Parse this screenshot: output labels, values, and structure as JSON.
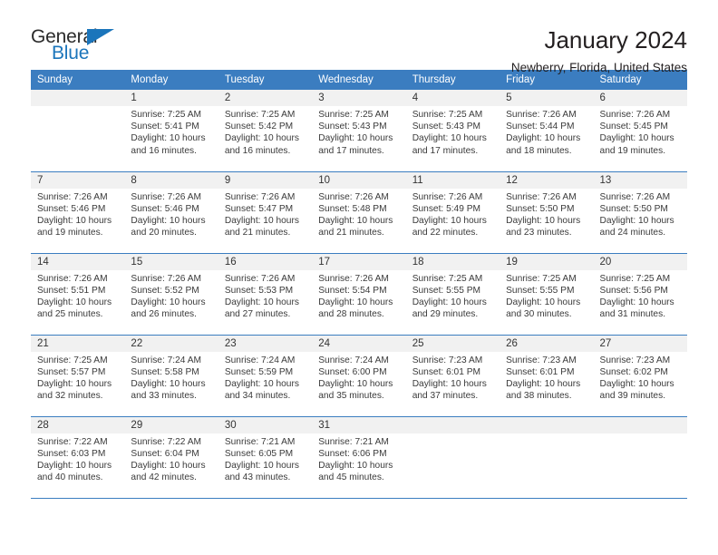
{
  "brand": {
    "name_top": "General",
    "name_bottom": "Blue",
    "triangle_icon": "triangle-icon",
    "color_primary": "#1b75bb",
    "color_text": "#2b2b2b"
  },
  "header": {
    "title": "January 2024",
    "subtitle": "Newberry, Florida, United States"
  },
  "calendar": {
    "header_background": "#3b7dc0",
    "header_text_color": "#ffffff",
    "daynum_band_color": "#f1f1f1",
    "weekday_headers": [
      "Sunday",
      "Monday",
      "Tuesday",
      "Wednesday",
      "Thursday",
      "Friday",
      "Saturday"
    ],
    "weeks": [
      [
        {
          "day": "",
          "lines": []
        },
        {
          "day": "1",
          "lines": [
            "Sunrise: 7:25 AM",
            "Sunset: 5:41 PM",
            "Daylight: 10 hours",
            "and 16 minutes."
          ]
        },
        {
          "day": "2",
          "lines": [
            "Sunrise: 7:25 AM",
            "Sunset: 5:42 PM",
            "Daylight: 10 hours",
            "and 16 minutes."
          ]
        },
        {
          "day": "3",
          "lines": [
            "Sunrise: 7:25 AM",
            "Sunset: 5:43 PM",
            "Daylight: 10 hours",
            "and 17 minutes."
          ]
        },
        {
          "day": "4",
          "lines": [
            "Sunrise: 7:25 AM",
            "Sunset: 5:43 PM",
            "Daylight: 10 hours",
            "and 17 minutes."
          ]
        },
        {
          "day": "5",
          "lines": [
            "Sunrise: 7:26 AM",
            "Sunset: 5:44 PM",
            "Daylight: 10 hours",
            "and 18 minutes."
          ]
        },
        {
          "day": "6",
          "lines": [
            "Sunrise: 7:26 AM",
            "Sunset: 5:45 PM",
            "Daylight: 10 hours",
            "and 19 minutes."
          ]
        }
      ],
      [
        {
          "day": "7",
          "lines": [
            "Sunrise: 7:26 AM",
            "Sunset: 5:46 PM",
            "Daylight: 10 hours",
            "and 19 minutes."
          ]
        },
        {
          "day": "8",
          "lines": [
            "Sunrise: 7:26 AM",
            "Sunset: 5:46 PM",
            "Daylight: 10 hours",
            "and 20 minutes."
          ]
        },
        {
          "day": "9",
          "lines": [
            "Sunrise: 7:26 AM",
            "Sunset: 5:47 PM",
            "Daylight: 10 hours",
            "and 21 minutes."
          ]
        },
        {
          "day": "10",
          "lines": [
            "Sunrise: 7:26 AM",
            "Sunset: 5:48 PM",
            "Daylight: 10 hours",
            "and 21 minutes."
          ]
        },
        {
          "day": "11",
          "lines": [
            "Sunrise: 7:26 AM",
            "Sunset: 5:49 PM",
            "Daylight: 10 hours",
            "and 22 minutes."
          ]
        },
        {
          "day": "12",
          "lines": [
            "Sunrise: 7:26 AM",
            "Sunset: 5:50 PM",
            "Daylight: 10 hours",
            "and 23 minutes."
          ]
        },
        {
          "day": "13",
          "lines": [
            "Sunrise: 7:26 AM",
            "Sunset: 5:50 PM",
            "Daylight: 10 hours",
            "and 24 minutes."
          ]
        }
      ],
      [
        {
          "day": "14",
          "lines": [
            "Sunrise: 7:26 AM",
            "Sunset: 5:51 PM",
            "Daylight: 10 hours",
            "and 25 minutes."
          ]
        },
        {
          "day": "15",
          "lines": [
            "Sunrise: 7:26 AM",
            "Sunset: 5:52 PM",
            "Daylight: 10 hours",
            "and 26 minutes."
          ]
        },
        {
          "day": "16",
          "lines": [
            "Sunrise: 7:26 AM",
            "Sunset: 5:53 PM",
            "Daylight: 10 hours",
            "and 27 minutes."
          ]
        },
        {
          "day": "17",
          "lines": [
            "Sunrise: 7:26 AM",
            "Sunset: 5:54 PM",
            "Daylight: 10 hours",
            "and 28 minutes."
          ]
        },
        {
          "day": "18",
          "lines": [
            "Sunrise: 7:25 AM",
            "Sunset: 5:55 PM",
            "Daylight: 10 hours",
            "and 29 minutes."
          ]
        },
        {
          "day": "19",
          "lines": [
            "Sunrise: 7:25 AM",
            "Sunset: 5:55 PM",
            "Daylight: 10 hours",
            "and 30 minutes."
          ]
        },
        {
          "day": "20",
          "lines": [
            "Sunrise: 7:25 AM",
            "Sunset: 5:56 PM",
            "Daylight: 10 hours",
            "and 31 minutes."
          ]
        }
      ],
      [
        {
          "day": "21",
          "lines": [
            "Sunrise: 7:25 AM",
            "Sunset: 5:57 PM",
            "Daylight: 10 hours",
            "and 32 minutes."
          ]
        },
        {
          "day": "22",
          "lines": [
            "Sunrise: 7:24 AM",
            "Sunset: 5:58 PM",
            "Daylight: 10 hours",
            "and 33 minutes."
          ]
        },
        {
          "day": "23",
          "lines": [
            "Sunrise: 7:24 AM",
            "Sunset: 5:59 PM",
            "Daylight: 10 hours",
            "and 34 minutes."
          ]
        },
        {
          "day": "24",
          "lines": [
            "Sunrise: 7:24 AM",
            "Sunset: 6:00 PM",
            "Daylight: 10 hours",
            "and 35 minutes."
          ]
        },
        {
          "day": "25",
          "lines": [
            "Sunrise: 7:23 AM",
            "Sunset: 6:01 PM",
            "Daylight: 10 hours",
            "and 37 minutes."
          ]
        },
        {
          "day": "26",
          "lines": [
            "Sunrise: 7:23 AM",
            "Sunset: 6:01 PM",
            "Daylight: 10 hours",
            "and 38 minutes."
          ]
        },
        {
          "day": "27",
          "lines": [
            "Sunrise: 7:23 AM",
            "Sunset: 6:02 PM",
            "Daylight: 10 hours",
            "and 39 minutes."
          ]
        }
      ],
      [
        {
          "day": "28",
          "lines": [
            "Sunrise: 7:22 AM",
            "Sunset: 6:03 PM",
            "Daylight: 10 hours",
            "and 40 minutes."
          ]
        },
        {
          "day": "29",
          "lines": [
            "Sunrise: 7:22 AM",
            "Sunset: 6:04 PM",
            "Daylight: 10 hours",
            "and 42 minutes."
          ]
        },
        {
          "day": "30",
          "lines": [
            "Sunrise: 7:21 AM",
            "Sunset: 6:05 PM",
            "Daylight: 10 hours",
            "and 43 minutes."
          ]
        },
        {
          "day": "31",
          "lines": [
            "Sunrise: 7:21 AM",
            "Sunset: 6:06 PM",
            "Daylight: 10 hours",
            "and 45 minutes."
          ]
        },
        {
          "day": "",
          "lines": []
        },
        {
          "day": "",
          "lines": []
        },
        {
          "day": "",
          "lines": []
        }
      ]
    ]
  }
}
